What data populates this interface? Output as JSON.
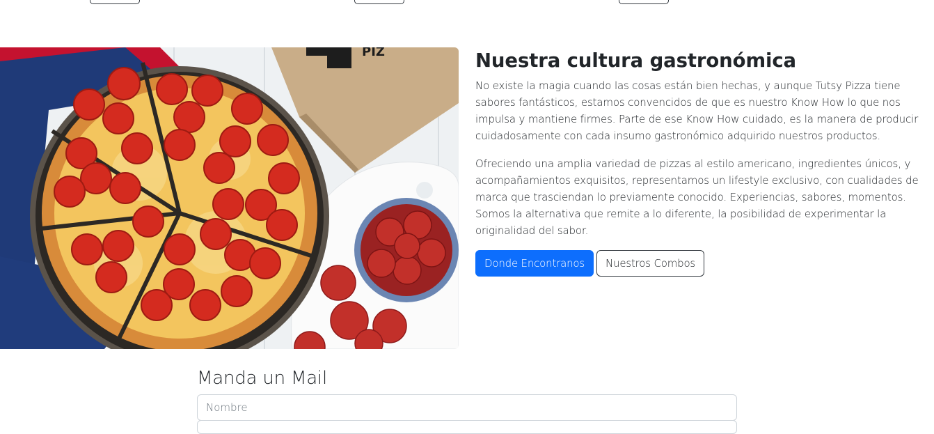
{
  "about": {
    "image_alt": "Pepperoni pizza",
    "box_print": "PIZ",
    "title": "Nuestra cultura gastronómica",
    "paragraphs": [
      "No existe la magia cuando las cosas están bien hechas, y aunque Tutsy Pizza tiene sabores fantásticos, estamos convencidos de que es nuestro Know How lo que nos impulsa y mantiene firmes. Parte de ese Know How cuidado, es la manera de producir cuidadosamente con cada insumo gastronómico adquirido nuestros productos.",
      "Ofreciendo una amplia variedad de pizzas al estilo americano, ingredientes únicos, y acompañamientos exquisitos, representamos un lifestyle exclusivo, con cualidades de marca que trasciendan lo previamente conocido. Experiencias, sabores, momentos. Somos la alternativa que remite a lo diferente, la posibilidad de experimentar la originalidad del sabor."
    ],
    "buttons": {
      "primary": "Donde Encontranos",
      "secondary": "Nuestros Combos"
    }
  },
  "mail": {
    "title": "Manda un Mail",
    "name_placeholder": "Nombre"
  },
  "colors": {
    "primary": "#0d6efd",
    "text": "#212529",
    "border": "#ced4da"
  }
}
